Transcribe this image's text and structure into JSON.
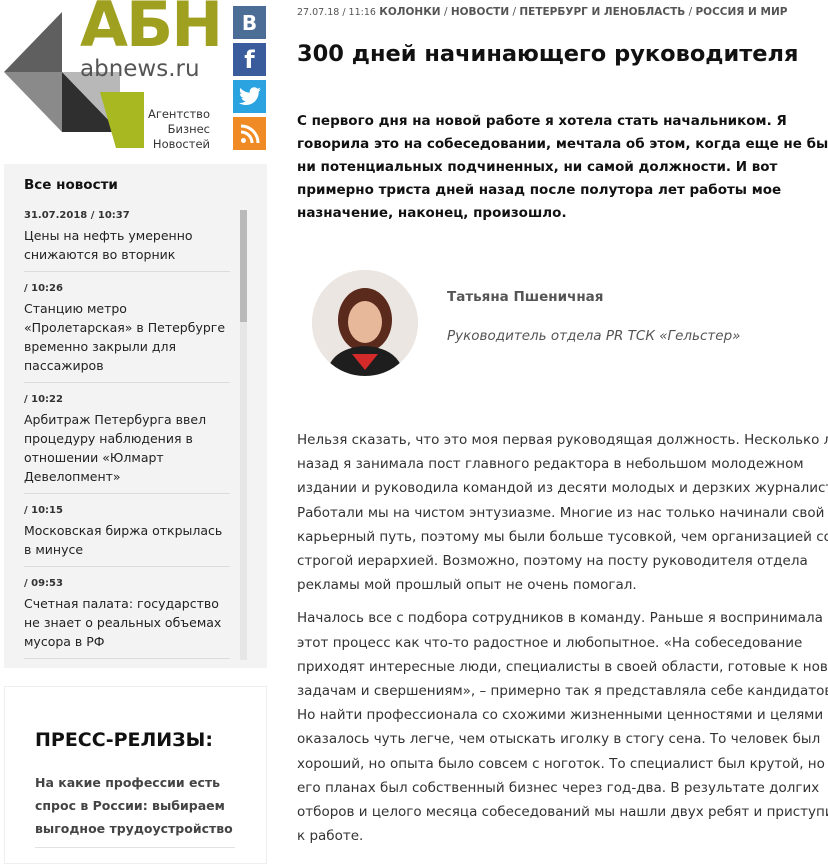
{
  "logo": {
    "brand": "АБН",
    "domain": "abnews.ru",
    "tagline": [
      "Агентство",
      "Бизнес",
      "Новостей"
    ]
  },
  "social": [
    {
      "name": "vk",
      "glyph": "В",
      "color": "#4c6e96"
    },
    {
      "name": "facebook",
      "glyph": "f",
      "color": "#3b5c9c"
    },
    {
      "name": "twitter",
      "icon": "twitter-bird-icon",
      "color": "#2aa3e0"
    },
    {
      "name": "rss",
      "icon": "rss-icon",
      "color": "#f08a24"
    }
  ],
  "news": {
    "title": "Все новости",
    "items": [
      {
        "time": "31.07.2018 / 10:37",
        "headline": "Цены на нефть умеренно снижаются во вторник"
      },
      {
        "time": "/ 10:26",
        "headline": "Станцию метро «Пролетарская» в Петербурге временно закрыли для пассажиров"
      },
      {
        "time": "/ 10:22",
        "headline": "Арбитраж Петербурга ввел процедуру наблюдения в отношении «Юлмарт Девелопмент»"
      },
      {
        "time": "/ 10:15",
        "headline": "Московская биржа открылась в минусе"
      },
      {
        "time": "/ 09:53",
        "headline": "Счетная палата: государство не знает о реальных объемах мусора в РФ"
      }
    ]
  },
  "press": {
    "title": "ПРЕСС-РЕЛИЗЫ:",
    "items": [
      {
        "headline": "На какие профессии есть спрос в России: выбираем выгодное трудоустройство"
      }
    ]
  },
  "article": {
    "date": "27.07.18 / 11:16",
    "categories": [
      "КОЛОНКИ",
      "НОВОСТИ",
      "ПЕТЕРБУРГ И ЛЕНОБЛАСТЬ",
      "РОССИЯ И МИР"
    ],
    "title": "300 дней начинающего руководителя",
    "lead": "С первого дня на новой работе я хотела стать начальником. Я говорила это на собеседовании, мечтала об этом, когда еще не было ни потенциальных подчиненных, ни самой должности. И вот примерно триста дней назад после полутора лет работы мое назначение, наконец, произошло.",
    "author": {
      "name": "Татьяна Пшеничная",
      "role": "Руководитель отдела PR ТСК «Гельстер»"
    },
    "paragraphs": [
      "Нельзя сказать, что это моя первая руководящая должность. Несколько лет назад я занимала пост главного редактора в небольшом молодежном издании и руководила командой из десяти молодых и дерзких журналистов. Работали мы на чистом энтузиазме. Многие из нас только начинали свой карьерный путь, поэтому мы были больше тусовкой, чем организацией со строгой иерархией. Возможно, поэтому на посту руководителя отдела рекламы мой прошлый опыт не очень помогал.",
      "Началось все с подбора сотрудников в команду. Раньше я воспринимала этот процесс как что-то радостное и любопытное. «На собеседование приходят интересные люди, специалисты в своей области, готовые к новым задачам и свершениям», – примерно так я представляла себе кандидатов. Но найти профессионала со схожими жизненными ценностями и целями оказалось чуть легче, чем отыскать иголку в стогу сена. То человек был хороший, но опыта было совсем с ноготок. То специалист был крутой, но в его планах был собственный бизнес через год-два. В результате долгих отборов и целого месяца собеседований мы нашли двух ребят и приступили к работе."
    ]
  }
}
